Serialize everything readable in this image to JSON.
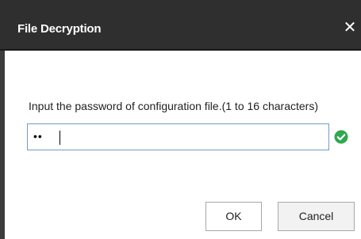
{
  "dialog": {
    "title": "File Decryption",
    "close_symbol": "✕",
    "prompt": "Input the password of configuration file.(1 to 16 characters)",
    "password": {
      "masked_value": "••",
      "valid_icon": "check-circle-icon",
      "valid_color": "#2fa84f"
    },
    "buttons": {
      "ok_label": "OK",
      "cancel_label": "Cancel"
    }
  },
  "colors": {
    "title_bar": "#2f2f2f",
    "field_border": "#6f9bd1"
  }
}
